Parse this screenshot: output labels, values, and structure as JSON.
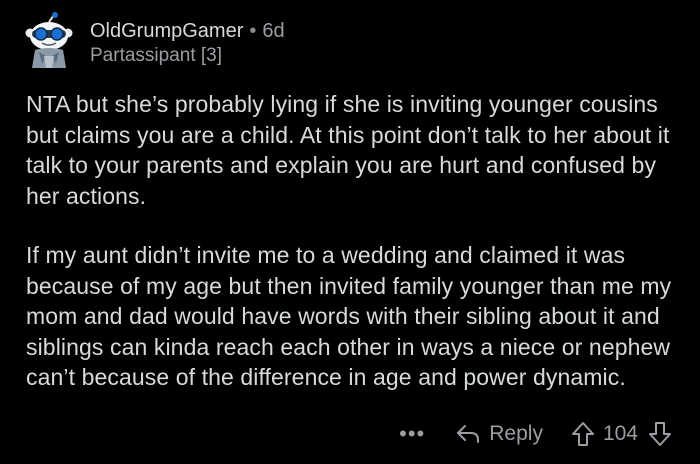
{
  "comment": {
    "author": "OldGrumpGamer",
    "separator": "•",
    "age": "6d",
    "flair": "Partassipant [3]",
    "paragraphs": [
      "NTA but she’s probably lying if she is inviting younger cousins but claims you are a child. At this point don’t talk to her about it talk to your parents and explain you are hurt and confused by her actions.",
      "If my aunt didn’t invite me to a wedding and claimed it was because of my age but then invited family younger than me my mom and dad would have words with their sibling about it and siblings can kinda reach each other in ways a niece or nephew can’t because of the difference in age and power dynamic."
    ]
  },
  "actions": {
    "more_label": "•••",
    "reply_label": "Reply",
    "vote_count": "104"
  },
  "icons": {
    "avatar": "snoo-avatar-icon",
    "more": "more-options-icon",
    "reply": "reply-arrow-icon",
    "upvote": "upvote-arrow-icon",
    "downvote": "downvote-arrow-icon"
  },
  "colors": {
    "background": "#000000",
    "text": "#d7dadc",
    "muted": "#9a9ea2"
  }
}
